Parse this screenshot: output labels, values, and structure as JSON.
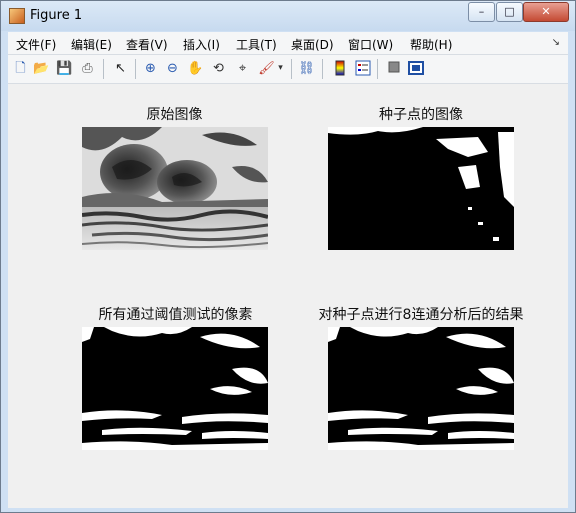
{
  "window": {
    "title": "Figure 1"
  },
  "window_controls": {
    "minimize": "–",
    "maximize": "□",
    "close": "✕"
  },
  "menu": [
    "文件(F)",
    "编辑(E)",
    "查看(V)",
    "插入(I)",
    "工具(T)",
    "桌面(D)",
    "窗口(W)",
    "帮助(H)"
  ],
  "toolbar": [
    "new-figure-icon",
    "open-file-icon",
    "save-icon",
    "print-icon",
    "select-pointer-icon",
    "zoom-in-icon",
    "zoom-out-icon",
    "pan-hand-icon",
    "rotate-3d-icon",
    "data-cursor-icon",
    "brush-icon",
    "brush-dropdown-icon",
    "link-plot-icon",
    "colorbar-icon",
    "legend-icon",
    "hide-plot-tools-icon",
    "show-plot-tools-icon"
  ],
  "panels": [
    {
      "title": "原始图像"
    },
    {
      "title": "种子点的图像"
    },
    {
      "title": "所有通过阈值测试的像素"
    },
    {
      "title": "对种子点进行8连通分析后的结果"
    }
  ]
}
